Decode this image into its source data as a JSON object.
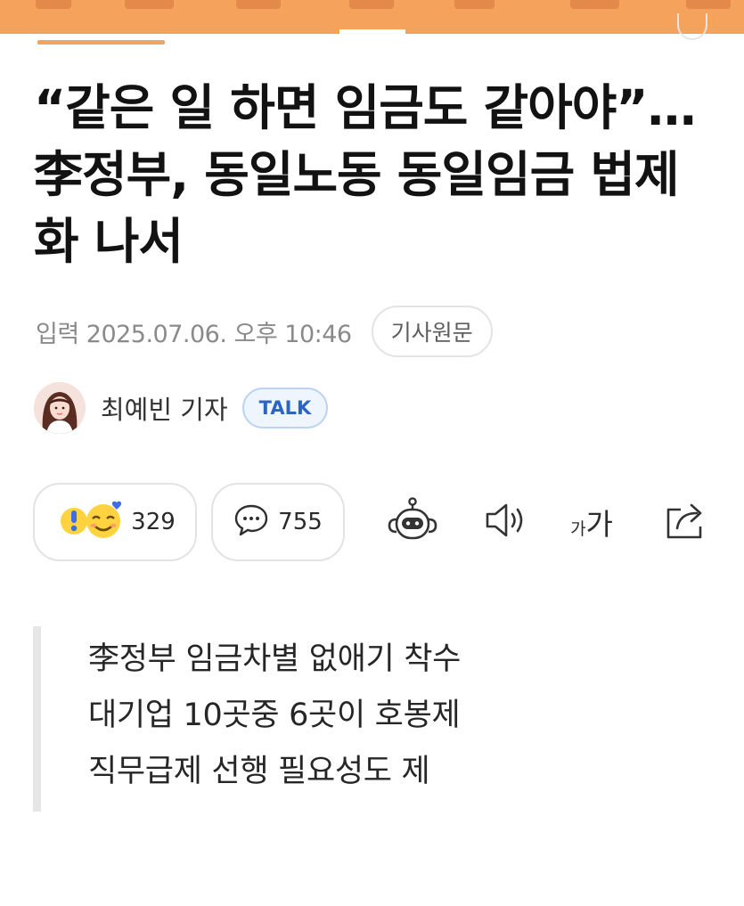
{
  "article": {
    "headline": "“같은 일 하면 임금도 같아야”…李정부, 동일노동 동일임금 법제화 나서",
    "published": "입력 2025.07.06. 오후 10:46",
    "source_button": "기사원문",
    "author": {
      "name": "최예빈 기자",
      "talk_label": "TALK"
    },
    "reactions": {
      "count": "329"
    },
    "comments": {
      "count": "755"
    },
    "font_size_icon_text": {
      "small": "가",
      "large": "가"
    },
    "summary": [
      "李정부 임금차별 없애기 착수",
      "대기업 10곳중 6곳이 호봉제",
      "직무급제 선행 필요성도 제"
    ]
  },
  "colors": {
    "accent_orange": "#f4a25c",
    "talk_blue": "#2c64c2"
  },
  "icons": [
    "reaction-emoji-icon",
    "comment-bubble-icon",
    "robot-summary-icon",
    "speaker-icon",
    "font-size-icon",
    "share-icon"
  ]
}
